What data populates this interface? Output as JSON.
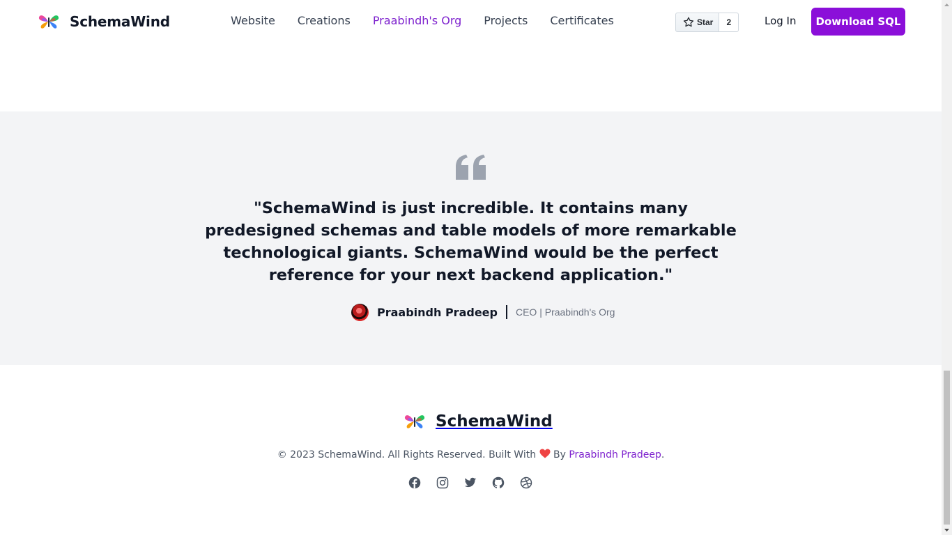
{
  "header": {
    "brand": "SchemaWind",
    "nav": [
      "Website",
      "Creations",
      "Praabindh's Org",
      "Projects",
      "Certificates"
    ],
    "active_nav": "Praabindh's Org",
    "star_label": "Star",
    "star_count": "2",
    "login_label": "Log In",
    "download_label": "Download SQL"
  },
  "testimonial": {
    "quote": "\"SchemaWind is just incredible. It contains many predesigned schemas and table models of more remarkable technological giants. SchemaWind would be the perfect reference for your next backend application.\"",
    "author_name": "Praabindh Pradeep",
    "author_role": "CEO | Praabindh's Org"
  },
  "footer": {
    "brand": "SchemaWind",
    "copyright_prefix": "© 2023 SchemaWind. All Rights Reserved. Built With",
    "copyright_by": "By",
    "author_link": "Praabindh Pradeep",
    "copyright_suffix": ".",
    "socials": [
      "facebook-icon",
      "instagram-icon",
      "twitter-icon",
      "github-icon",
      "dribbble-icon"
    ]
  },
  "colors": {
    "accent": "#8b0fd9",
    "link": "#7e22ce",
    "testimonial_bg": "#f3f4f6",
    "heart": "#ef4444"
  }
}
